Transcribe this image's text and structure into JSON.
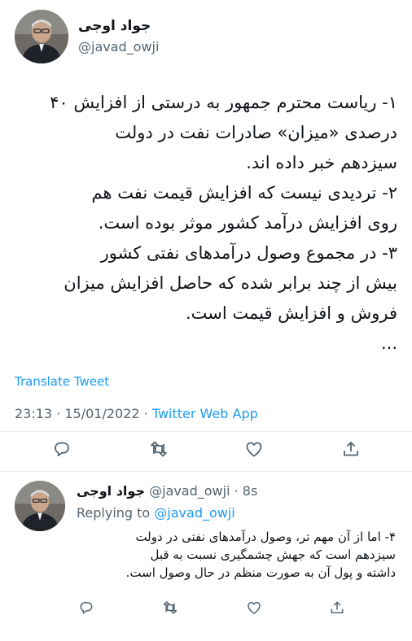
{
  "tweet": {
    "author_name": "جواد اوجی",
    "author_handle": "@javad_owji",
    "body_lines": [
      "۱- ریاست محترم جمهور به درستی از افزایش ۴۰",
      "درصدی «میزان» صادرات نفت در دولت",
      "سیزدهم خبر داده اند.",
      "۲- تردیدی نیست که افزایش قیمت نفت هم",
      "روی افزایش درآمد کشور موثر بوده است.",
      "۳- در مجموع وصول درآمدهای نفتی کشور",
      "بیش از چند برابر شده که حاصل افزایش میزان",
      "فروش و افزایش قیمت است.",
      "..."
    ],
    "translate_label": "Translate Tweet",
    "timestamp": "23:13 · 15/01/2022 · ",
    "source": "Twitter Web App"
  },
  "actions": {
    "reply_icon": "reply-icon",
    "retweet_icon": "retweet-icon",
    "like_icon": "like-icon",
    "share_icon": "share-icon"
  },
  "reply": {
    "author_name": "جواد اوجی",
    "meta": " @javad_owji · 8s",
    "replying_prefix": "Replying to ",
    "replying_handle": "@javad_owji",
    "body_lines": [
      "۴- اما از آن مهم تر، وصول درآمدهای نفتی در دولت",
      "سیزدهم است که جهش چشمگیری نسبت به قبل",
      "داشته و پول آن به صورت منظم در حال وصول است."
    ]
  },
  "colors": {
    "link": "#1d9bf0",
    "muted": "#536471",
    "text": "#0f1419",
    "divider": "#e6ecf0"
  }
}
